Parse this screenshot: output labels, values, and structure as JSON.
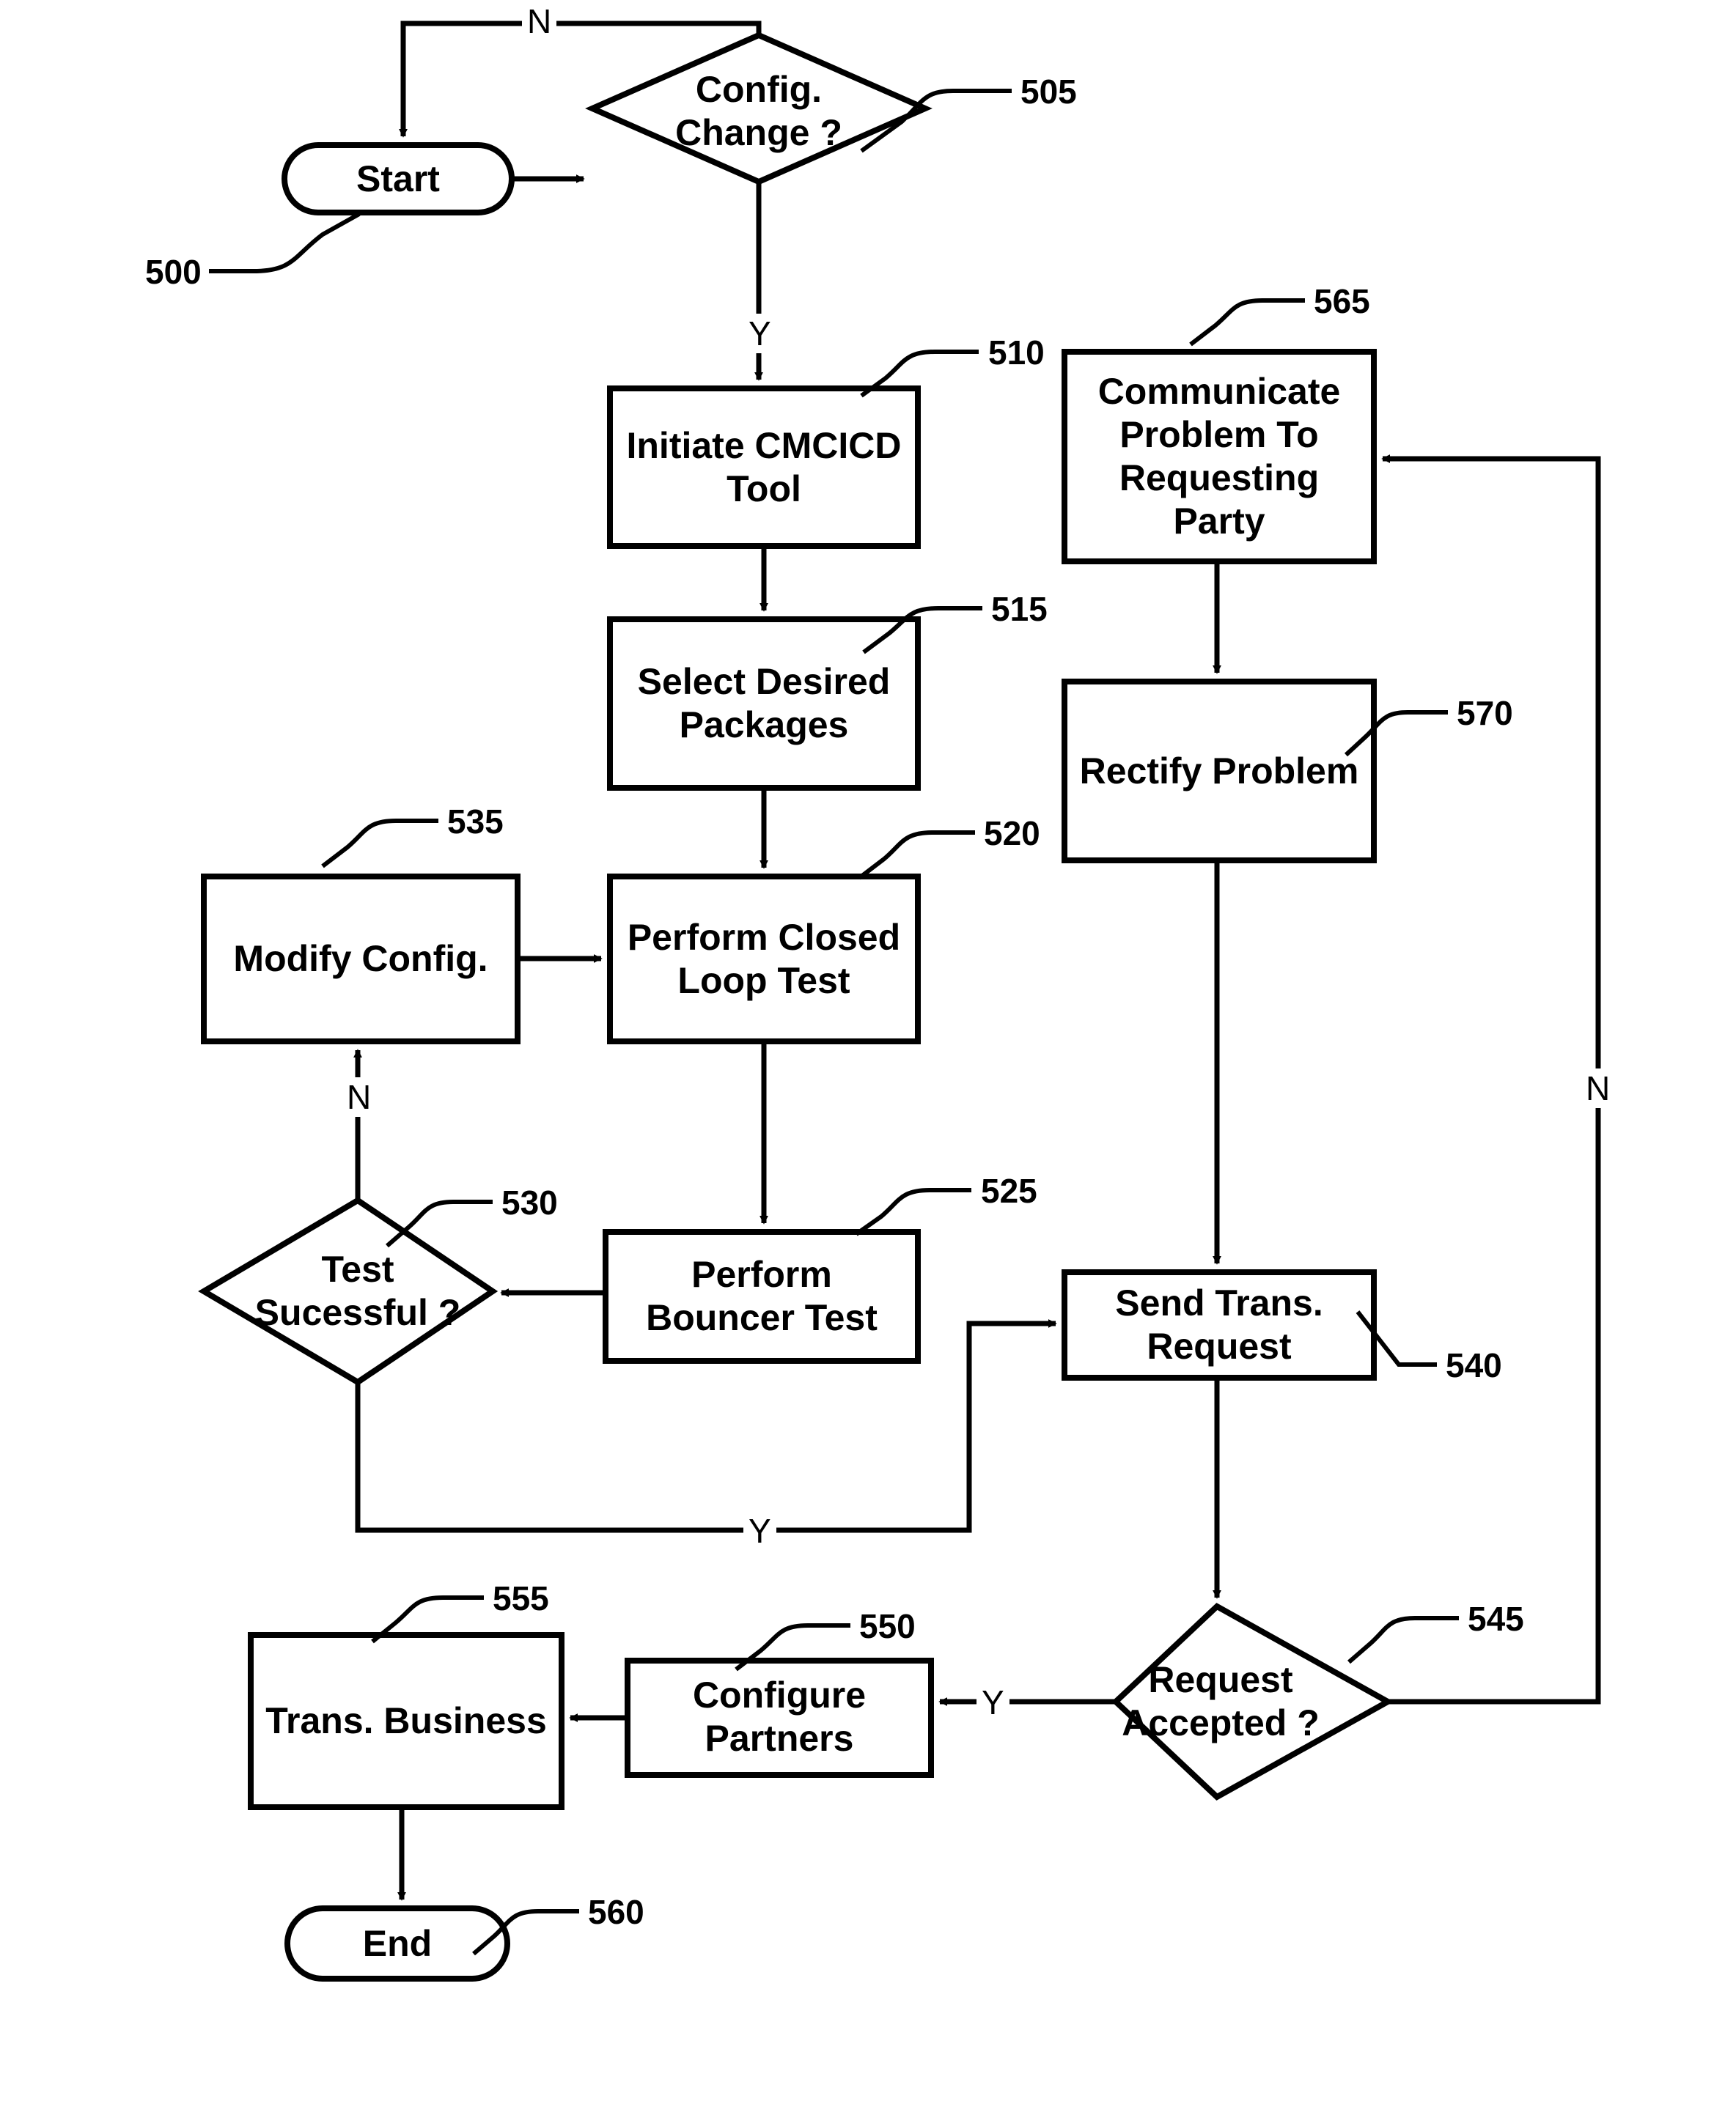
{
  "figure": {
    "type": "flowchart",
    "background": "#ffffff",
    "stroke": "#000000"
  },
  "nodes": {
    "start": {
      "label": "Start",
      "ref": "500",
      "shape": "terminator"
    },
    "q505": {
      "label": "Config.\nChange ?",
      "ref": "505",
      "shape": "decision"
    },
    "n510": {
      "label": "Initiate CMCICD\nTool",
      "ref": "510",
      "shape": "process"
    },
    "n515": {
      "label": "Select Desired\nPackages",
      "ref": "515",
      "shape": "process"
    },
    "n520": {
      "label": "Perform Closed\nLoop Test",
      "ref": "520",
      "shape": "process"
    },
    "n525": {
      "label": "Perform\nBouncer Test",
      "ref": "525",
      "shape": "process"
    },
    "q530": {
      "label": "Test\nSucessful ?",
      "ref": "530",
      "shape": "decision"
    },
    "n535": {
      "label": "Modify Config.",
      "ref": "535",
      "shape": "process"
    },
    "n540": {
      "label": "Send Trans.\nRequest",
      "ref": "540",
      "shape": "process"
    },
    "q545": {
      "label": "Request\nAccepted ?",
      "ref": "545",
      "shape": "decision"
    },
    "n550": {
      "label": "Configure\nPartners",
      "ref": "550",
      "shape": "process"
    },
    "n555": {
      "label": "Trans. Business",
      "ref": "555",
      "shape": "process"
    },
    "end": {
      "label": "End",
      "ref": "560",
      "shape": "terminator"
    },
    "n565": {
      "label": "Communicate\nProblem To\nRequesting\nParty",
      "ref": "565",
      "shape": "process"
    },
    "n570": {
      "label": "Rectify Problem",
      "ref": "570",
      "shape": "process"
    }
  },
  "edge_labels": {
    "config_change_no": "N",
    "config_change_yes": "Y",
    "test_sucessful_no": "N",
    "test_sucessful_yes": "Y",
    "request_accepted_yes": "Y",
    "request_accepted_no": "N"
  }
}
